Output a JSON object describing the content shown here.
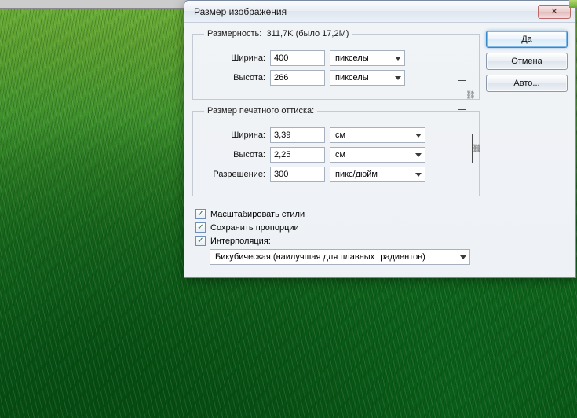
{
  "dialog": {
    "title": "Размер изображения",
    "close_glyph": "✕"
  },
  "pixel_group": {
    "legend_prefix": "Размерность:",
    "size_current": "311,7K",
    "size_was_label": "(было 17,2M)",
    "width_label": "Ширина:",
    "width_value": "400",
    "height_label": "Высота:",
    "height_value": "266",
    "unit": "пикселы"
  },
  "print_group": {
    "legend": "Размер печатного оттиска:",
    "width_label": "Ширина:",
    "width_value": "3,39",
    "height_label": "Высота:",
    "height_value": "2,25",
    "unit": "см",
    "res_label": "Разрешение:",
    "res_value": "300",
    "res_unit": "пикс/дюйм"
  },
  "checks": {
    "scale_styles": "Масштабировать стили",
    "constrain": "Сохранить пропорции",
    "interp_label": "Интерполяция:",
    "interp_value": "Бикубическая (наилучшая для плавных градиентов)"
  },
  "buttons": {
    "ok": "Да",
    "cancel": "Отмена",
    "auto": "Авто..."
  },
  "glyphs": {
    "check": "✓",
    "link": "⛓"
  }
}
